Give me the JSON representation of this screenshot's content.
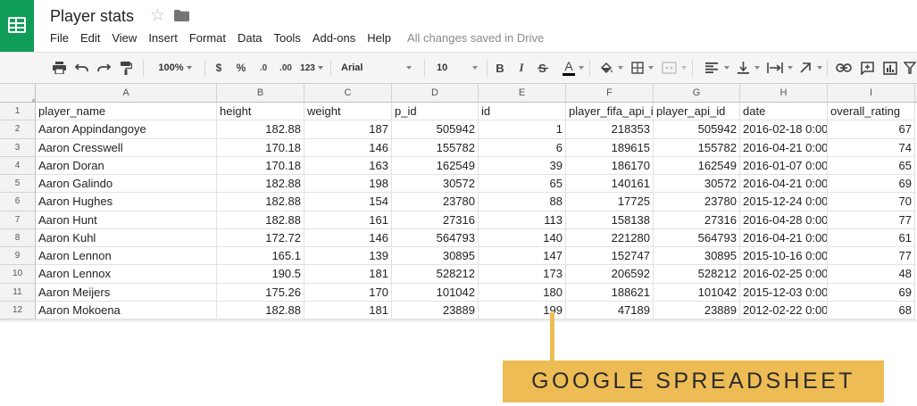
{
  "window": {
    "title": "Player stats",
    "save_status": "All changes saved in Drive"
  },
  "menu": [
    "File",
    "Edit",
    "View",
    "Insert",
    "Format",
    "Data",
    "Tools",
    "Add-ons",
    "Help"
  ],
  "toolbar": {
    "zoom": "100%",
    "currency": "$",
    "percent": "%",
    "decrease_decimals": ".0",
    "increase_decimals": ".00",
    "more_formats": "123",
    "font": "Arial",
    "font_size": "10",
    "bold": "B",
    "italic": "I",
    "text_color": "A",
    "icons": [
      "print-icon",
      "undo-icon",
      "redo-icon",
      "paint-format-icon",
      "strikethrough-icon",
      "fill-color-icon",
      "borders-icon",
      "merge-cells-icon",
      "align-left-icon",
      "valign-icon",
      "text-wrap-icon",
      "text-rotation-icon",
      "link-icon",
      "comment-icon",
      "chart-icon",
      "filter-icon"
    ]
  },
  "grid": {
    "columns": [
      "A",
      "B",
      "C",
      "D",
      "E",
      "F",
      "G",
      "H",
      "I"
    ],
    "row_numbers": [
      "1",
      "2",
      "3",
      "4",
      "5",
      "6",
      "7",
      "8",
      "9",
      "10",
      "11",
      "12"
    ],
    "header_row": [
      "player_name",
      "height",
      "weight",
      "p_id",
      "id",
      "player_fifa_api_id",
      "player_api_id",
      "date",
      "overall_rating"
    ],
    "rows": [
      [
        "Aaron Appindangoye",
        "182.88",
        "187",
        "505942",
        "1",
        "218353",
        "505942",
        "2016-02-18 0:00:",
        "67"
      ],
      [
        "Aaron Cresswell",
        "170.18",
        "146",
        "155782",
        "6",
        "189615",
        "155782",
        "2016-04-21 0:00:",
        "74"
      ],
      [
        "Aaron Doran",
        "170.18",
        "163",
        "162549",
        "39",
        "186170",
        "162549",
        "2016-01-07 0:00:",
        "65"
      ],
      [
        "Aaron Galindo",
        "182.88",
        "198",
        "30572",
        "65",
        "140161",
        "30572",
        "2016-04-21 0:00:",
        "69"
      ],
      [
        "Aaron Hughes",
        "182.88",
        "154",
        "23780",
        "88",
        "17725",
        "23780",
        "2015-12-24 0:00:",
        "70"
      ],
      [
        "Aaron Hunt",
        "182.88",
        "161",
        "27316",
        "113",
        "158138",
        "27316",
        "2016-04-28 0:00:",
        "77"
      ],
      [
        "Aaron Kuhl",
        "172.72",
        "146",
        "564793",
        "140",
        "221280",
        "564793",
        "2016-04-21 0:00:",
        "61"
      ],
      [
        "Aaron Lennon",
        "165.1",
        "139",
        "30895",
        "147",
        "152747",
        "30895",
        "2015-10-16 0:00:",
        "77"
      ],
      [
        "Aaron Lennox",
        "190.5",
        "181",
        "528212",
        "173",
        "206592",
        "528212",
        "2016-02-25 0:00:",
        "48"
      ],
      [
        "Aaron Meijers",
        "175.26",
        "170",
        "101042",
        "180",
        "188621",
        "101042",
        "2015-12-03 0:00:",
        "69"
      ],
      [
        "Aaron Mokoena",
        "182.88",
        "181",
        "23889",
        "199",
        "47189",
        "23889",
        "2012-02-22 0:00:",
        "68"
      ]
    ],
    "numeric_columns": [
      false,
      true,
      true,
      true,
      true,
      true,
      true,
      false,
      true
    ]
  },
  "caption": {
    "text": "GOOGLE SPREADSHEET",
    "color": "#eebc55"
  },
  "colors": {
    "brand": "#0f9d58",
    "header_bg": "#f3f3f3",
    "toolbar_bg": "#f5f5f5"
  }
}
